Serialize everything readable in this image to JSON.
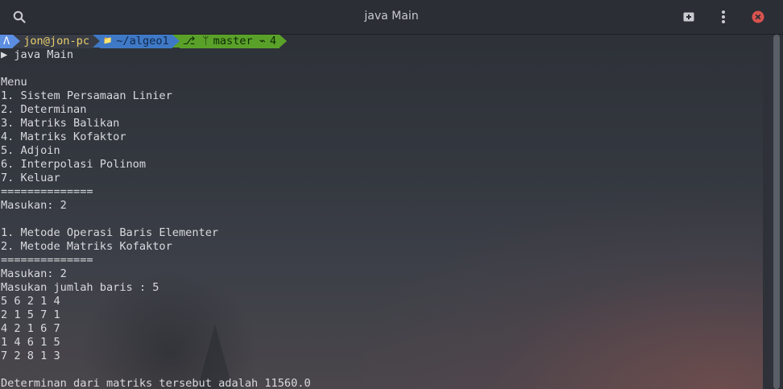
{
  "window": {
    "title": "java Main"
  },
  "prompt": {
    "os_glyph": "Λ",
    "user_host": "jon@jon-pc",
    "dir_glyph": "📁",
    "dir": "~/algeo1",
    "git_icon": "⎇",
    "branch_glyph": "ᛘ",
    "branch": "master",
    "stash_glyph": "⌁",
    "stash_count": "4",
    "command_glyph": "▶",
    "command": "java Main"
  },
  "output": [
    "",
    "Menu",
    "1. Sistem Persamaan Linier",
    "2. Determinan",
    "3. Matriks Balikan",
    "4. Matriks Kofaktor",
    "5. Adjoin",
    "6. Interpolasi Polinom",
    "7. Keluar",
    "==============",
    "Masukan: 2",
    "",
    "1. Metode Operasi Baris Elementer",
    "2. Metode Matriks Kofaktor",
    "==============",
    "Masukan: 2",
    "Masukan jumlah baris : 5",
    "5 6 2 1 4",
    "2 1 5 7 1",
    "4 2 1 6 7",
    "1 4 6 1 5",
    "7 2 8 1 3",
    "",
    "Determinan dari matriks tersebut adalah 11560.0"
  ],
  "colors": {
    "titlebar": "#2b2e35",
    "close_button": "#d9534f",
    "text": "#d8dade",
    "os_segment": "#5b8de0",
    "user_segment": "#393c45",
    "dir_segment": "#3f79c6",
    "git_segment": "#5aa12a"
  }
}
